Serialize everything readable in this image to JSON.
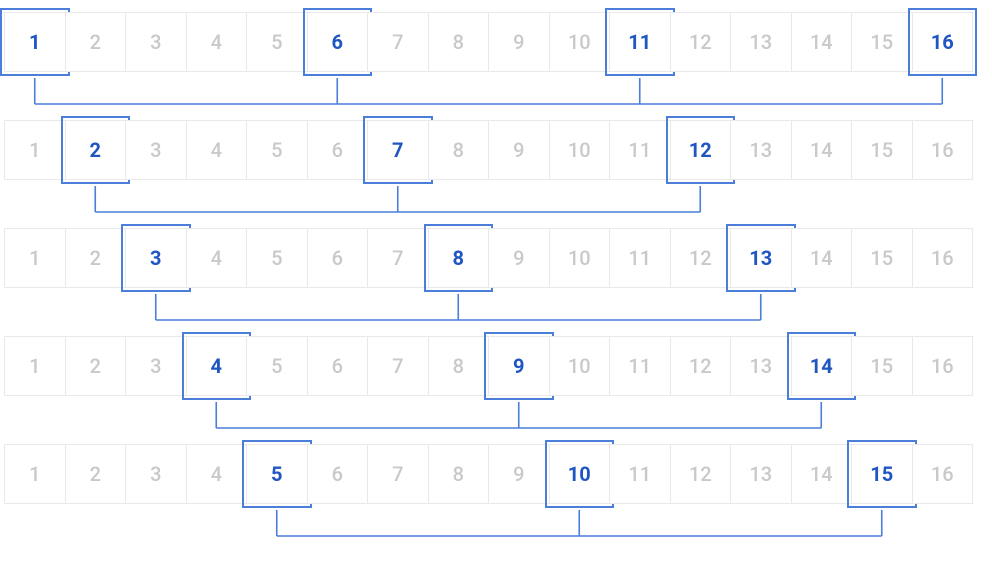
{
  "diagram": {
    "cellsPerRow": 16,
    "cellLabels": [
      "1",
      "2",
      "3",
      "4",
      "5",
      "6",
      "7",
      "8",
      "9",
      "10",
      "11",
      "12",
      "13",
      "14",
      "15",
      "16"
    ],
    "colors": {
      "highlight": "#4a7ed9",
      "muted": "#c9c9c9",
      "grid": "#e9e9e9"
    },
    "rows": [
      {
        "highlighted": [
          1,
          6,
          11,
          16
        ]
      },
      {
        "highlighted": [
          2,
          7,
          12
        ]
      },
      {
        "highlighted": [
          3,
          8,
          13
        ]
      },
      {
        "highlighted": [
          4,
          9,
          14
        ]
      },
      {
        "highlighted": [
          5,
          10,
          15
        ]
      }
    ],
    "connectorDrop": 32,
    "chart_note": "Each row is a 1x16 grid. Highlighted cells per row form arithmetic sequences with step 5 starting at row-index+1. Highlighted cells in a row are linked by a bracket connector below the row."
  },
  "chart_data": {
    "type": "table",
    "title": "",
    "columns": 16,
    "rows": 5,
    "categories": [
      "1",
      "2",
      "3",
      "4",
      "5",
      "6",
      "7",
      "8",
      "9",
      "10",
      "11",
      "12",
      "13",
      "14",
      "15",
      "16"
    ],
    "series": [
      {
        "name": "row-1-highlights",
        "values": [
          1,
          6,
          11,
          16
        ]
      },
      {
        "name": "row-2-highlights",
        "values": [
          2,
          7,
          12
        ]
      },
      {
        "name": "row-3-highlights",
        "values": [
          3,
          8,
          13
        ]
      },
      {
        "name": "row-4-highlights",
        "values": [
          4,
          9,
          14
        ]
      },
      {
        "name": "row-5-highlights",
        "values": [
          5,
          10,
          15
        ]
      }
    ],
    "xlabel": "",
    "ylabel": "",
    "legend": false
  }
}
